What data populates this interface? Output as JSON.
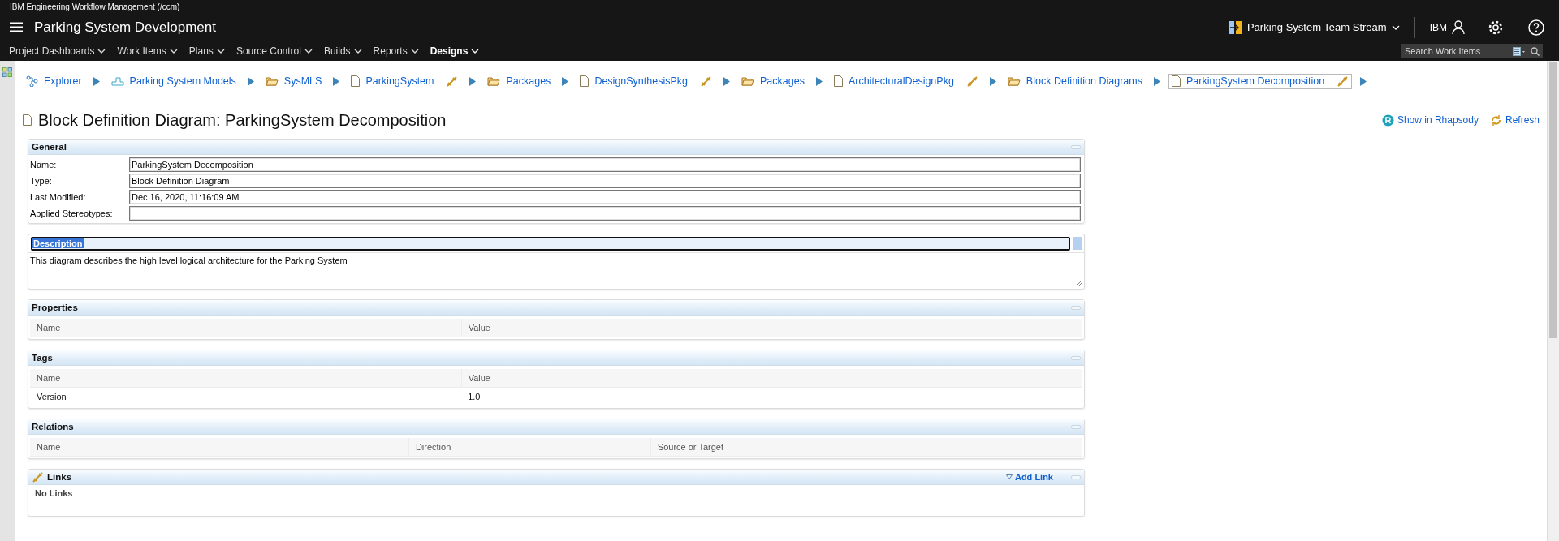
{
  "app_title": "IBM Engineering Workflow Management (/ccm)",
  "project": "Parking System Development",
  "stream": "Parking System Team Stream",
  "user": "IBM",
  "nav": [
    {
      "label": "Project Dashboards",
      "selected": false
    },
    {
      "label": "Work Items",
      "selected": false
    },
    {
      "label": "Plans",
      "selected": false
    },
    {
      "label": "Source Control",
      "selected": false
    },
    {
      "label": "Builds",
      "selected": false
    },
    {
      "label": "Reports",
      "selected": false
    },
    {
      "label": "Designs",
      "selected": true
    }
  ],
  "search": {
    "placeholder": "Search Work Items"
  },
  "breadcrumb": [
    {
      "label": "Explorer",
      "kind": "explorer",
      "linked": false,
      "selected": false
    },
    {
      "label": "Parking System Models",
      "kind": "models",
      "linked": false,
      "selected": false
    },
    {
      "label": "SysMLS",
      "kind": "folder",
      "linked": false,
      "selected": false
    },
    {
      "label": "ParkingSystem",
      "kind": "document",
      "linked": true,
      "selected": false
    },
    {
      "label": "Packages",
      "kind": "folder",
      "linked": false,
      "selected": false
    },
    {
      "label": "DesignSynthesisPkg",
      "kind": "document",
      "linked": true,
      "selected": false
    },
    {
      "label": "Packages",
      "kind": "folder",
      "linked": false,
      "selected": false
    },
    {
      "label": "ArchitecturalDesignPkg",
      "kind": "document",
      "linked": true,
      "selected": false
    },
    {
      "label": "Block Definition Diagrams",
      "kind": "folder",
      "linked": false,
      "selected": false
    },
    {
      "label": "ParkingSystem Decomposition",
      "kind": "document",
      "linked": true,
      "selected": true
    }
  ],
  "heading": "Block Definition Diagram: ParkingSystem Decomposition",
  "actions": [
    {
      "label": "Show in Rhapsody",
      "kind": "rhapsody"
    },
    {
      "label": "Refresh",
      "kind": "refresh"
    }
  ],
  "general": {
    "title": "General",
    "fields": [
      {
        "label": "Name:",
        "value": "ParkingSystem Decomposition"
      },
      {
        "label": "Type:",
        "value": "Block Definition Diagram"
      },
      {
        "label": "Last Modified:",
        "value": "Dec 16, 2020, 11:16:09 AM"
      },
      {
        "label": "Applied Stereotypes:"
      }
    ]
  },
  "description": {
    "title": "Description",
    "text": "This diagram describes the high level logical architecture for the Parking System"
  },
  "tables": [
    {
      "title": "Properties",
      "columns": [
        "Name",
        "Value"
      ]
    },
    {
      "title": "Tags",
      "columns": [
        "Name",
        "Value"
      ],
      "rows": [
        [
          "Version",
          "1.0"
        ]
      ]
    },
    {
      "title": "Relations",
      "columns": [
        "Name",
        "Direction",
        "Source or Target"
      ]
    }
  ],
  "links": {
    "title": "Links",
    "add": "Add Link",
    "empty": "No Links"
  }
}
